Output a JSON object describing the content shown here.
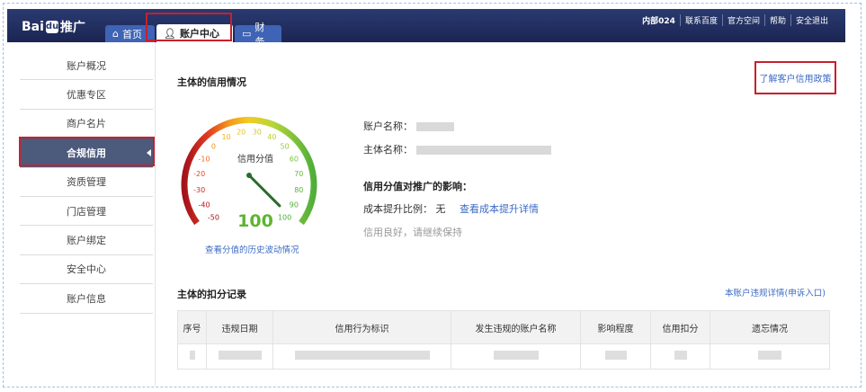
{
  "header": {
    "logo_text": "Bai",
    "logo_suffix": "推广",
    "tabs": [
      {
        "label": "首页",
        "icon": "home-icon"
      },
      {
        "label": "账户中心",
        "icon": "user-icon"
      },
      {
        "label": "财务",
        "icon": "card-icon"
      }
    ],
    "nav": [
      "内部024",
      "联系百度",
      "官方空间",
      "帮助",
      "安全退出"
    ]
  },
  "sidebar": {
    "items": [
      "账户概况",
      "优惠专区",
      "商户名片",
      "合规信用",
      "资质管理",
      "门店管理",
      "账户绑定",
      "安全中心",
      "账户信息"
    ],
    "active": "合规信用"
  },
  "credit": {
    "title": "主体的信用情况",
    "policy_link": "了解客户信用政策",
    "gauge_label": "信用分值",
    "score": "100",
    "score_value": 100,
    "ticks": [
      "-50",
      "-40",
      "-30",
      "-20",
      "-10",
      "0",
      "10",
      "20",
      "30",
      "40",
      "50",
      "60",
      "70",
      "80",
      "90",
      "100"
    ],
    "history_link": "查看分值的历史波动情况",
    "account_name_label": "账户名称：",
    "entity_name_label": "主体名称：",
    "impact_title": "信用分值对推广的影响：",
    "cost_label": "成本提升比例：",
    "cost_value": "无",
    "cost_link": "查看成本提升详情",
    "status_note": "信用良好，请继续保持"
  },
  "deductions": {
    "title": "主体的扣分记录",
    "appeal_link": "本账户违规详情(申诉入口)",
    "columns": [
      "序号",
      "违规日期",
      "信用行为标识",
      "发生违规的账户名称",
      "影响程度",
      "信用扣分",
      "遗忘情况"
    ]
  },
  "colors": {
    "topbar": "#1e2a5a",
    "tab_blue": "#3f63b5",
    "sidebar_active": "#4c5a7c",
    "highlight": "#c8202c",
    "score_green": "#5cb531",
    "link": "#3b6bc4"
  }
}
